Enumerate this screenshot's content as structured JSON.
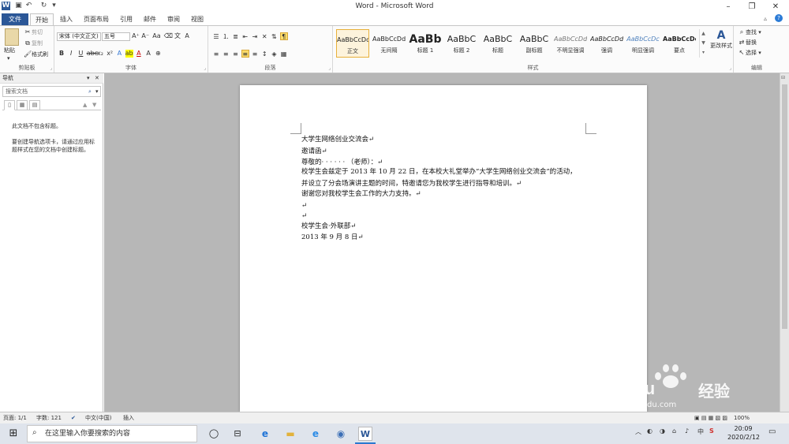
{
  "window": {
    "title": "Word - Microsoft Word"
  },
  "tabs": [
    {
      "label": "文件"
    },
    {
      "label": "开始"
    },
    {
      "label": "插入"
    },
    {
      "label": "页面布局"
    },
    {
      "label": "引用"
    },
    {
      "label": "邮件"
    },
    {
      "label": "审阅"
    },
    {
      "label": "视图"
    }
  ],
  "ribbon": {
    "clipboard": {
      "paste_label": "粘贴",
      "cut_label": "剪切",
      "copy_label": "复制",
      "format_painter_label": "格式刷",
      "group_label": "剪贴板"
    },
    "font": {
      "font_name": "宋体 (中文正文)",
      "font_size": "五号",
      "group_label": "字体"
    },
    "paragraph": {
      "group_label": "段落"
    },
    "styles": {
      "group_label": "样式",
      "items": [
        {
          "sample": "AaBbCcDd",
          "name": "正文"
        },
        {
          "sample": "AaBbCcDd",
          "name": "无间隔"
        },
        {
          "sample": "AaBb",
          "name": "标题 1"
        },
        {
          "sample": "AaBbC",
          "name": "标题 2"
        },
        {
          "sample": "AaBbC",
          "name": "标题"
        },
        {
          "sample": "AaBbC",
          "name": "副标题"
        },
        {
          "sample": "AaBbCcDd",
          "name": "不明显强调"
        },
        {
          "sample": "AaBbCcDd",
          "name": "强调"
        },
        {
          "sample": "AaBbCcDc",
          "name": "明显强调"
        },
        {
          "sample": "AaBbCcDc",
          "name": "要点"
        }
      ],
      "change_styles_label": "更改样式"
    },
    "editing": {
      "find_label": "查找",
      "replace_label": "替换",
      "select_label": "选择",
      "group_label": "编辑"
    }
  },
  "nav": {
    "title": "导航",
    "search_placeholder": "搜索文档",
    "msg1": "此文档不包含标题。",
    "msg2": "要创建导航选项卡，请通过应用标题样式在您的文档中创建标题。"
  },
  "document": {
    "lines": [
      "大学生网络创业交流会↵",
      "邀请函↵",
      "尊敬的· · · · · · （老师）：↵",
      "校学生会兹定于 2013 年 10 月 22 日，在本校大礼堂举办“大学生网络创业交流会”的活动，",
      "并设立了分会场演讲主题的时间，特邀请您为我校学生进行指导和培训。↵",
      "谢谢您对我校学生会工作的大力支持。↵",
      "↵",
      "↵",
      "校学生会·外联部↵",
      "2013 年 9 月 8 日↵"
    ]
  },
  "status": {
    "page": "页面: 1/1",
    "words": "字数: 121",
    "language": "中文(中国)",
    "mode": "插入",
    "zoom": "100%"
  },
  "taskbar": {
    "search_placeholder": "在这里输入你要搜索的内容",
    "time": "20:09",
    "date": "2020/2/12",
    "ime": "中"
  },
  "watermark": {
    "brand": "Bai du",
    "cn": "经验",
    "url": "jingyan.baidu.com"
  }
}
